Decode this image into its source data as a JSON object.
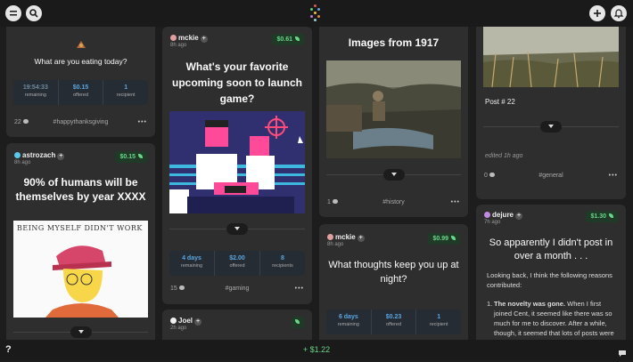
{
  "colors": {
    "accent": "#6bd68a",
    "stat_blue": "#5aa6e0",
    "card_bg": "#2e2e2e",
    "page_bg": "#1d1d1d"
  },
  "topbar": {
    "menu_icon": "menu-icon",
    "search_icon": "search-icon",
    "add_icon": "plus-icon",
    "bell_icon": "bell-icon"
  },
  "bottombar": {
    "help": "?",
    "balance": "+ $1.22"
  },
  "col1": {
    "card1": {
      "title": "What are you eating today?",
      "stats": [
        {
          "value": "19:54:33",
          "label": "remaining"
        },
        {
          "value": "$0.15",
          "label": "offered"
        },
        {
          "value": "1",
          "label": "recipient"
        }
      ],
      "comments": "22",
      "tag": "#happythanksgiving",
      "more": "•••"
    },
    "card2": {
      "author": "astrozach",
      "ago": "8h ago",
      "tip": "$0.15",
      "title": "90% of humans will be themselves by year XXXX",
      "image_caption": "BEING MYSELF DIDN'T WORK"
    }
  },
  "col2": {
    "card1": {
      "author": "mckie",
      "ago": "8h ago",
      "tip": "$0.61",
      "title": "What's your favorite upcoming soon to launch game?",
      "stats": [
        {
          "value": "4 days",
          "label": "remaining"
        },
        {
          "value": "$2.00",
          "label": "offered"
        },
        {
          "value": "8",
          "label": "recipients"
        }
      ],
      "comments": "15",
      "tag": "#gaming",
      "more": "•••"
    },
    "card2": {
      "author": "Joel",
      "ago": "2h ago"
    }
  },
  "col3": {
    "card1": {
      "title": "Images from 1917",
      "comments": "1",
      "tag": "#history",
      "more": "•••"
    },
    "card2": {
      "author": "mckie",
      "ago": "8h ago",
      "tip": "$0.99",
      "title": "What thoughts keep you up at night?",
      "stats": [
        {
          "value": "6 days",
          "label": "remaining"
        },
        {
          "value": "$0.23",
          "label": "offered"
        },
        {
          "value": "1",
          "label": "recipient"
        }
      ]
    }
  },
  "col4": {
    "card1": {
      "post_label": "Post # 22",
      "edited": "edited 1h ago",
      "comments": "0",
      "tag": "#general",
      "more": "•••"
    },
    "card2": {
      "author": "dejure",
      "ago": "7h ago",
      "tip": "$1.30",
      "title": "So apparently I didn't post in over a month . . .",
      "intro": "Looking back, I think the following reasons contributed:",
      "list_bold": "The novelty was gone.",
      "list_text": " When I first joined Cent, it seemed like there was so much for me to discover. After a while, though, it seemed that lots of posts were similar to"
    }
  }
}
